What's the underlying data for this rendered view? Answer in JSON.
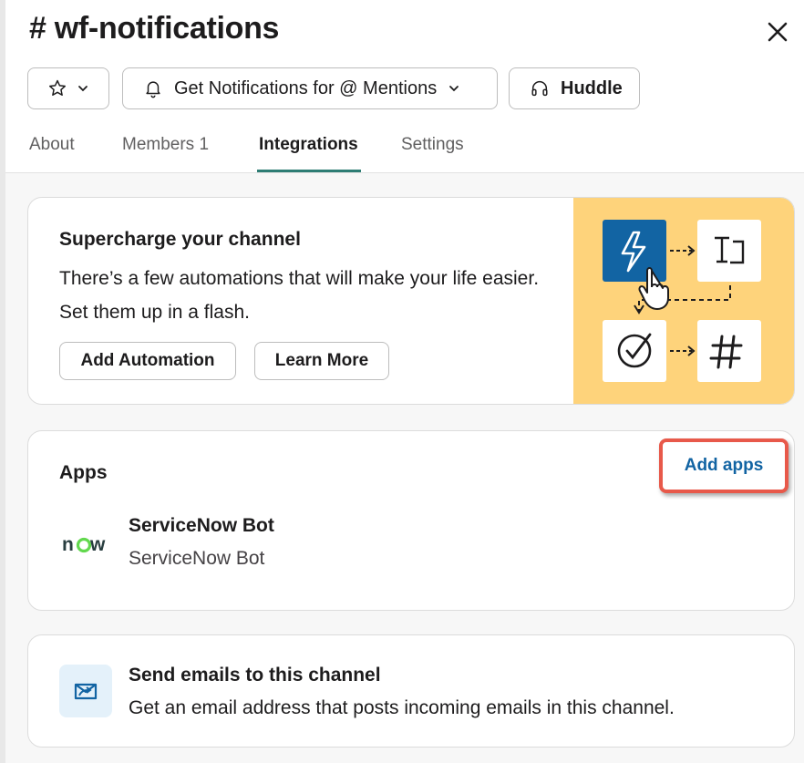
{
  "header": {
    "title": "# wf-notifications",
    "notif_label": "Get Notifications for @ Mentions",
    "huddle_label": "Huddle"
  },
  "tabs": [
    {
      "label": "About"
    },
    {
      "label": "Members 1"
    },
    {
      "label": "Integrations"
    },
    {
      "label": "Settings"
    }
  ],
  "active_tab": "Integrations",
  "supercharge": {
    "title": "Supercharge your channel",
    "description": "There’s a few automations that will make your life easier. Set them up in a flash.",
    "add_automation_label": "Add Automation",
    "learn_more_label": "Learn More"
  },
  "apps": {
    "title": "Apps",
    "add_apps_label": "Add apps",
    "items": [
      {
        "logo_text": "now",
        "name": "ServiceNow Bot",
        "subtitle": "ServiceNow Bot"
      }
    ]
  },
  "email": {
    "title": "Send emails to this channel",
    "description": "Get an email address that posts incoming emails in this channel."
  },
  "colors": {
    "accent": "#2e7d74",
    "link": "#1264a3",
    "highlight": "#e8594a",
    "illustration_bg": "#fed37b",
    "bolt_tile": "#1264a3",
    "servicenow_green": "#62d84e"
  },
  "icons": {
    "close": "close-icon",
    "star": "star-icon",
    "bell": "bell-icon",
    "headphones": "headphones-icon",
    "email": "email-forward-icon"
  }
}
